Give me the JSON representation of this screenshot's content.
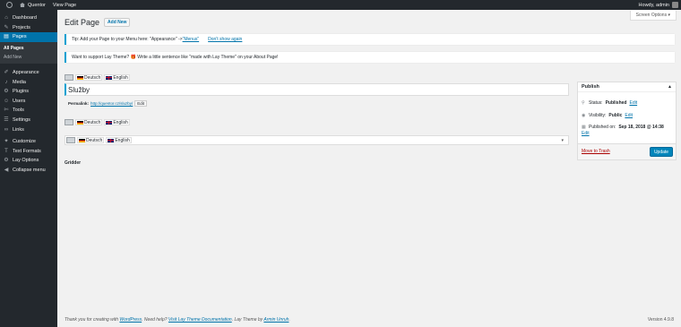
{
  "adminbar": {
    "site_name": "Quentor",
    "view_page": "View Page",
    "greeting": "Howdy, admin"
  },
  "sidebar": {
    "items": [
      {
        "label": "Dashboard",
        "icon": "dashboard-icon",
        "glyph": "⌂"
      },
      {
        "label": "Projects",
        "icon": "pin-icon",
        "glyph": "✎"
      },
      {
        "label": "Pages",
        "icon": "pages-icon",
        "glyph": "▤",
        "current": true
      },
      {
        "label": "Appearance",
        "icon": "brush-icon",
        "glyph": "✐"
      },
      {
        "label": "Media",
        "icon": "media-icon",
        "glyph": "♪"
      },
      {
        "label": "Plugins",
        "icon": "plugins-icon",
        "glyph": "⚙"
      },
      {
        "label": "Users",
        "icon": "users-icon",
        "glyph": "☺"
      },
      {
        "label": "Tools",
        "icon": "tools-icon",
        "glyph": "✄"
      },
      {
        "label": "Settings",
        "icon": "settings-icon",
        "glyph": "☰"
      },
      {
        "label": "Links",
        "icon": "links-icon",
        "glyph": "∞"
      },
      {
        "label": "Customize",
        "icon": "customize-icon",
        "glyph": "✦"
      },
      {
        "label": "Text Formats",
        "icon": "text-icon",
        "glyph": "T"
      },
      {
        "label": "Lay Options",
        "icon": "lay-options-icon",
        "glyph": "⚙"
      },
      {
        "label": "Collapse menu",
        "icon": "collapse-icon",
        "glyph": "◀"
      }
    ],
    "submenu": [
      "All Pages",
      "Add New"
    ]
  },
  "header": {
    "title": "Edit Page",
    "add_new": "Add New",
    "screen_options": "Screen Options ▾"
  },
  "notices": {
    "tip_text": "Tip: Add your Page to your Menu here: \"Appearance\" -> ",
    "tip_link": "\"Menus\"",
    "tip_dismiss": "Don't show again",
    "support_text": "Want to support Lay Theme? 🎁 Write a little sentence like \"made with Lay Theme\" on your About Page!"
  },
  "languages": {
    "deutsch": "Deutsch",
    "english": "English"
  },
  "editor": {
    "title_value": "Služby",
    "permalink_label": "Permalink:",
    "permalink_url": "http://quentor.cz/sluzby/",
    "permalink_edit": "Edit",
    "gridder": "Gridder"
  },
  "publish": {
    "title": "Publish",
    "status_label": "Status:",
    "status_value": "Published",
    "visibility_label": "Visibility:",
    "visibility_value": "Public",
    "published_label": "Published on:",
    "published_value": "Sep 18, 2018 @ 14:38",
    "edit": "Edit",
    "trash": "Move to Trash",
    "update": "Update"
  },
  "footer": {
    "text1": "Thank you for creating with ",
    "wordpress": "WordPress",
    "text2": ". Need help? ",
    "lay_docs": "Visit Lay Theme Documentation",
    "text3": ". Lay Theme by ",
    "author": "Armin Unruh",
    "text4": ".",
    "version": "Version 4.9.8"
  },
  "colors": {
    "accent": "#0073aa",
    "admin_dark": "#23282d",
    "notice_border": "#00a0d2",
    "button": "#0085ba"
  }
}
